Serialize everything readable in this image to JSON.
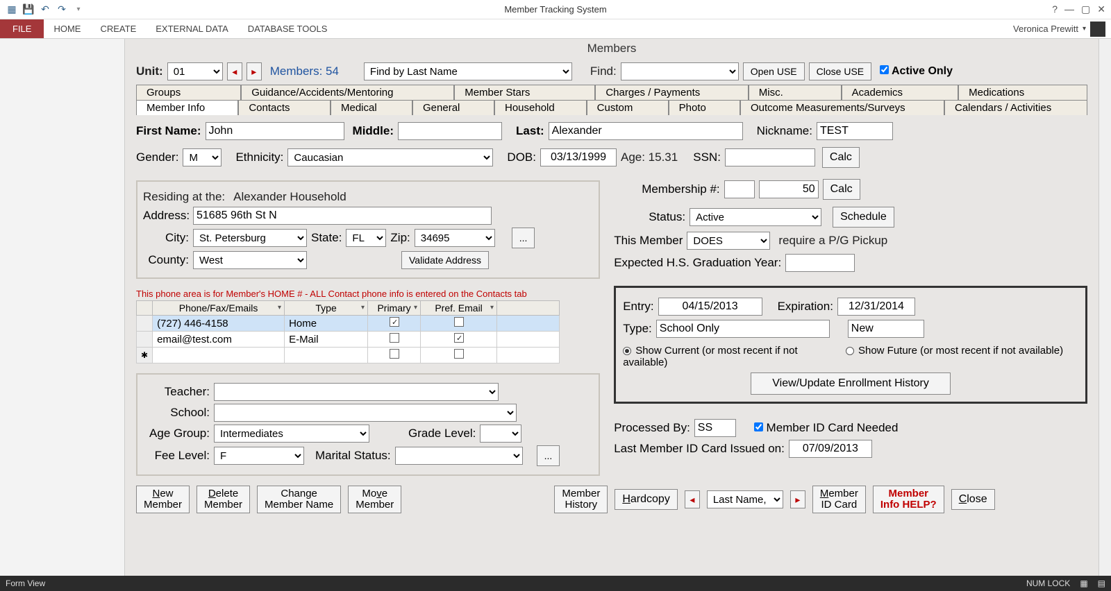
{
  "app": {
    "title": "Member Tracking System",
    "user": "Veronica Prewitt"
  },
  "ribbon": {
    "file": "FILE",
    "home": "HOME",
    "create": "CREATE",
    "external": "EXTERNAL DATA",
    "dbtools": "DATABASE TOOLS"
  },
  "header": {
    "formtitle": "Members"
  },
  "toolbar": {
    "unit_lbl": "Unit:",
    "unit_val": "01",
    "members_lbl": "Members: 54",
    "findby_val": "Find by Last Name",
    "find_lbl": "Find:",
    "openuse": "Open USE",
    "closeuse": "Close USE",
    "activeonly": "Active Only"
  },
  "tabs1": {
    "groups": "Groups",
    "guidance": "Guidance/Accidents/Mentoring",
    "stars": "Member Stars",
    "charges": "Charges / Payments",
    "misc": "Misc.",
    "academics": "Academics",
    "medications": "Medications"
  },
  "tabs2": {
    "memberinfo": "Member Info",
    "contacts": "Contacts",
    "medical": "Medical",
    "general": "General",
    "household": "Household",
    "custom": "Custom",
    "photo": "Photo",
    "outcome": "Outcome Measurements/Surveys",
    "calendars": "Calendars / Activities"
  },
  "name": {
    "first_lbl": "First Name:",
    "first": "John",
    "middle_lbl": "Middle:",
    "middle": "",
    "last_lbl": "Last:",
    "last": "Alexander",
    "nick_lbl": "Nickname:",
    "nick": "TEST"
  },
  "demo": {
    "gender_lbl": "Gender:",
    "gender": "M",
    "eth_lbl": "Ethnicity:",
    "eth": "Caucasian",
    "dob_lbl": "DOB:",
    "dob": "03/13/1999",
    "age_lbl": "Age: 15.31",
    "ssn_lbl": "SSN:",
    "calc": "Calc"
  },
  "addr": {
    "residing": "Residing at the:",
    "household": "Alexander Household",
    "address_lbl": "Address:",
    "address": "51685 96th St N",
    "city_lbl": "City:",
    "city": "St. Petersburg",
    "state_lbl": "State:",
    "state": "FL",
    "zip_lbl": "Zip:",
    "zip": "34695",
    "county_lbl": "County:",
    "county": "West",
    "validate": "Validate Address",
    "ellipsis": "..."
  },
  "phone": {
    "warn": "This phone area is for Member's HOME # - ALL Contact phone info is entered on the Contacts tab",
    "h1": "Phone/Fax/Emails",
    "h2": "Type",
    "h3": "Primary",
    "h4": "Pref. Email",
    "r1c1": "(727) 446-4158",
    "r1c2": "Home",
    "r2c1": "email@test.com",
    "r2c2": "E-Mail"
  },
  "school": {
    "teacher_lbl": "Teacher:",
    "school_lbl": "School:",
    "agegrp_lbl": "Age Group:",
    "agegrp": "Intermediates",
    "grade_lbl": "Grade Level:",
    "fee_lbl": "Fee Level:",
    "fee": "F",
    "marital_lbl": "Marital Status:",
    "ellipsis": "..."
  },
  "mem": {
    "memno_lbl": "Membership #:",
    "memno2": "50",
    "calc": "Calc",
    "status_lbl": "Status:",
    "status": "Active",
    "schedule": "Schedule",
    "thismem": "This Member",
    "does": "DOES",
    "require": "require a P/G Pickup",
    "gradyr": "Expected H.S. Graduation Year:"
  },
  "enroll": {
    "entry_lbl": "Entry:",
    "entry": "04/15/2013",
    "exp_lbl": "Expiration:",
    "exp": "12/31/2014",
    "type_lbl": "Type:",
    "type": "School Only",
    "type2": "New",
    "showcur": "Show Current (or most recent if not available)",
    "showfut": "Show Future (or most recent if not available)",
    "viewupdate": "View/Update Enrollment History"
  },
  "proc": {
    "processedby_lbl": "Processed By:",
    "processedby": "SS",
    "cardneeded": "Member ID Card Needed",
    "lastissued_lbl": "Last Member ID Card Issued on:",
    "lastissued": "07/09/2013"
  },
  "btm": {
    "new": "New Member",
    "delete": "Delete Member",
    "change": "Change Member Name",
    "move": "Move Member",
    "history": "Member History",
    "hardcopy": "Hardcopy",
    "navval": "Last Name, F",
    "idcard": "Member ID Card",
    "help": "Member Info HELP?",
    "close": "Close"
  },
  "status": {
    "left": "Form View",
    "numlock": "NUM LOCK"
  }
}
